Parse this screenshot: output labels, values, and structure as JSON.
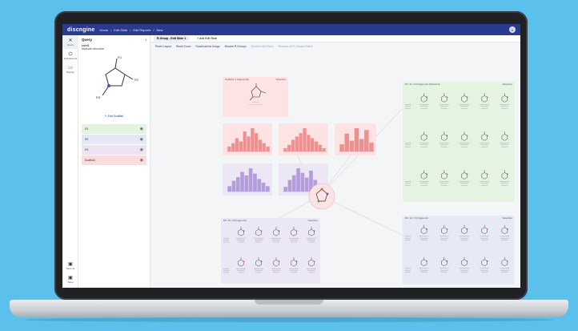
{
  "app": {
    "logo": "discngine",
    "breadcrumbs": [
      "Home",
      "Edit Slide",
      "Edit Reports",
      "New"
    ],
    "avatar": "A"
  },
  "rail": {
    "items": [
      {
        "label": "Query",
        "icon": "x-icon"
      },
      {
        "label": "Substituents",
        "icon": "molecule-icon"
      },
      {
        "label": "Display",
        "icon": "monitor-icon"
      }
    ],
    "bottom": [
      {
        "label": "Save as",
        "icon": "save-icon"
      },
      {
        "label": "Save",
        "icon": "save-icon"
      }
    ]
  },
  "query": {
    "title": "Query",
    "name": "core3",
    "subtitle": "Markush structure",
    "edit_label": "Edit Scaffold",
    "rgroups": [
      {
        "label": "R1",
        "color": "#e3f3df"
      },
      {
        "label": "R2",
        "color": "#e4e8f6"
      },
      {
        "label": "R3",
        "color": "#ece4f3"
      },
      {
        "label": "Scaffold",
        "color": "#fbdcdc"
      }
    ]
  },
  "tabs": {
    "active": "R-Group - Edit Slide 1",
    "add": "+ Add Edit Slide"
  },
  "toolbar": {
    "items": [
      "Reset Layout",
      "Reset Zoom",
      "Download As Image",
      "Browse R-Groups"
    ],
    "muted": [
      "Deselect All Filters",
      "Remove All R-Groups Filters"
    ]
  },
  "cards": {
    "scaffold_title": "Scaffold: 1 fragment(s)",
    "r1_title": "R1: 21 / 24 fragments (Selected)",
    "r2_title": "R2: 12 / 24 fragments",
    "r3_title": "R3: 10 / 24 fragments",
    "aside": "Selection"
  },
  "colors": {
    "brand": "#2a3a8e",
    "pink": "#fde3e3",
    "green": "#e4f4e1",
    "lavender": "#ece7f4",
    "blue": "#e6eaf5",
    "bar_pink": "#f08f8f",
    "bar_lav": "#b39ddb"
  }
}
